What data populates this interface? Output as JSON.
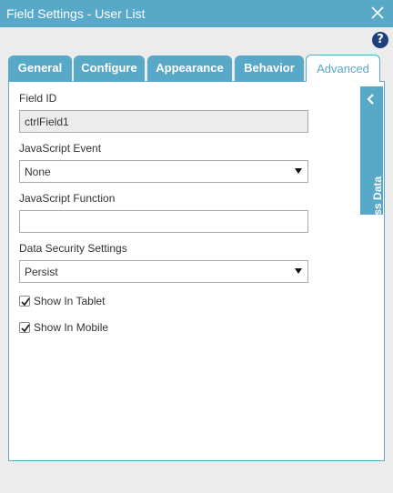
{
  "window": {
    "title": "Field Settings - User List",
    "close_icon": "close-icon"
  },
  "help": {
    "icon": "help-icon",
    "symbol": "?"
  },
  "tabs": [
    {
      "label": "General"
    },
    {
      "label": "Configure"
    },
    {
      "label": "Appearance"
    },
    {
      "label": "Behavior"
    },
    {
      "label": "Advanced",
      "active": true
    }
  ],
  "form": {
    "field_id": {
      "label": "Field ID",
      "value": "ctrlField1"
    },
    "js_event": {
      "label": "JavaScript Event",
      "value": "None"
    },
    "js_function": {
      "label": "JavaScript Function",
      "value": ""
    },
    "data_security": {
      "label": "Data Security Settings",
      "value": "Persist"
    },
    "show_in_tablet": {
      "label": "Show In Tablet",
      "checked": true
    },
    "show_in_mobile": {
      "label": "Show In Mobile",
      "checked": true
    }
  },
  "side_panel": {
    "label": "Process Data",
    "icon": "chevron-left-icon"
  },
  "colors": {
    "accent": "#58a8c8",
    "help": "#1f3f7a",
    "background": "#ececec"
  }
}
